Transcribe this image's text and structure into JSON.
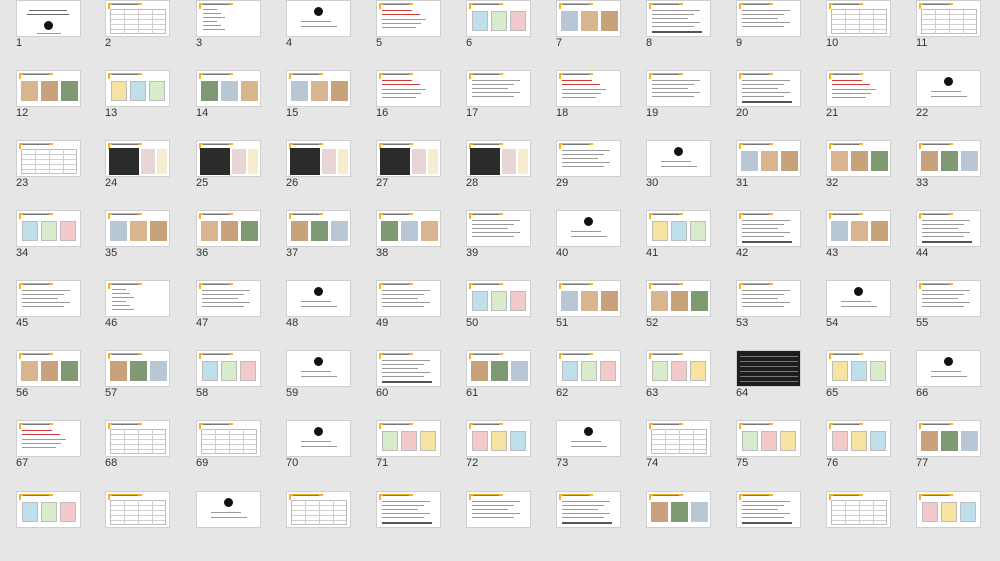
{
  "thumbnails": [
    {
      "n": "1",
      "k": "cover"
    },
    {
      "n": "2",
      "k": "table"
    },
    {
      "n": "3",
      "k": "list"
    },
    {
      "n": "4",
      "k": "section"
    },
    {
      "n": "5",
      "k": "textred"
    },
    {
      "n": "6",
      "k": "diagram"
    },
    {
      "n": "7",
      "k": "photo"
    },
    {
      "n": "8",
      "k": "text"
    },
    {
      "n": "9",
      "k": "text"
    },
    {
      "n": "10",
      "k": "table"
    },
    {
      "n": "11",
      "k": "table"
    },
    {
      "n": "12",
      "k": "photo"
    },
    {
      "n": "13",
      "k": "diagram"
    },
    {
      "n": "14",
      "k": "photo"
    },
    {
      "n": "15",
      "k": "photo"
    },
    {
      "n": "16",
      "k": "textred"
    },
    {
      "n": "17",
      "k": "text"
    },
    {
      "n": "18",
      "k": "textred"
    },
    {
      "n": "19",
      "k": "text"
    },
    {
      "n": "20",
      "k": "text"
    },
    {
      "n": "21",
      "k": "textred"
    },
    {
      "n": "22",
      "k": "section"
    },
    {
      "n": "23",
      "k": "table"
    },
    {
      "n": "24",
      "k": "darktable"
    },
    {
      "n": "25",
      "k": "darktable"
    },
    {
      "n": "26",
      "k": "darktable"
    },
    {
      "n": "27",
      "k": "darktable"
    },
    {
      "n": "28",
      "k": "darktable"
    },
    {
      "n": "29",
      "k": "text"
    },
    {
      "n": "30",
      "k": "section"
    },
    {
      "n": "31",
      "k": "photo"
    },
    {
      "n": "32",
      "k": "photo"
    },
    {
      "n": "33",
      "k": "photo"
    },
    {
      "n": "34",
      "k": "diagram"
    },
    {
      "n": "35",
      "k": "photo"
    },
    {
      "n": "36",
      "k": "photo"
    },
    {
      "n": "37",
      "k": "photo"
    },
    {
      "n": "38",
      "k": "photo"
    },
    {
      "n": "39",
      "k": "text"
    },
    {
      "n": "40",
      "k": "section"
    },
    {
      "n": "41",
      "k": "diagram"
    },
    {
      "n": "42",
      "k": "text"
    },
    {
      "n": "43",
      "k": "photo"
    },
    {
      "n": "44",
      "k": "text"
    },
    {
      "n": "45",
      "k": "text"
    },
    {
      "n": "46",
      "k": "list"
    },
    {
      "n": "47",
      "k": "text"
    },
    {
      "n": "48",
      "k": "section"
    },
    {
      "n": "49",
      "k": "text"
    },
    {
      "n": "50",
      "k": "diagram"
    },
    {
      "n": "51",
      "k": "photo"
    },
    {
      "n": "52",
      "k": "photo"
    },
    {
      "n": "53",
      "k": "text"
    },
    {
      "n": "54",
      "k": "section"
    },
    {
      "n": "55",
      "k": "text"
    },
    {
      "n": "56",
      "k": "photo"
    },
    {
      "n": "57",
      "k": "photo"
    },
    {
      "n": "58",
      "k": "diagram"
    },
    {
      "n": "59",
      "k": "section"
    },
    {
      "n": "60",
      "k": "text"
    },
    {
      "n": "61",
      "k": "photo"
    },
    {
      "n": "62",
      "k": "diagram"
    },
    {
      "n": "63",
      "k": "diagram"
    },
    {
      "n": "64",
      "k": "dark"
    },
    {
      "n": "65",
      "k": "diagram"
    },
    {
      "n": "66",
      "k": "section"
    },
    {
      "n": "67",
      "k": "textred"
    },
    {
      "n": "68",
      "k": "table"
    },
    {
      "n": "69",
      "k": "table"
    },
    {
      "n": "70",
      "k": "section"
    },
    {
      "n": "71",
      "k": "diagram"
    },
    {
      "n": "72",
      "k": "diagram"
    },
    {
      "n": "73",
      "k": "section"
    },
    {
      "n": "74",
      "k": "table"
    },
    {
      "n": "75",
      "k": "diagram"
    },
    {
      "n": "76",
      "k": "diagram"
    },
    {
      "n": "77",
      "k": "photo"
    },
    {
      "n": "",
      "k": "diagram"
    },
    {
      "n": "",
      "k": "table"
    },
    {
      "n": "",
      "k": "section"
    },
    {
      "n": "",
      "k": "table"
    },
    {
      "n": "",
      "k": "text"
    },
    {
      "n": "",
      "k": "text"
    },
    {
      "n": "",
      "k": "text"
    },
    {
      "n": "",
      "k": "photo"
    },
    {
      "n": "",
      "k": "text"
    },
    {
      "n": "",
      "k": "table"
    },
    {
      "n": "",
      "k": "diagram"
    }
  ]
}
